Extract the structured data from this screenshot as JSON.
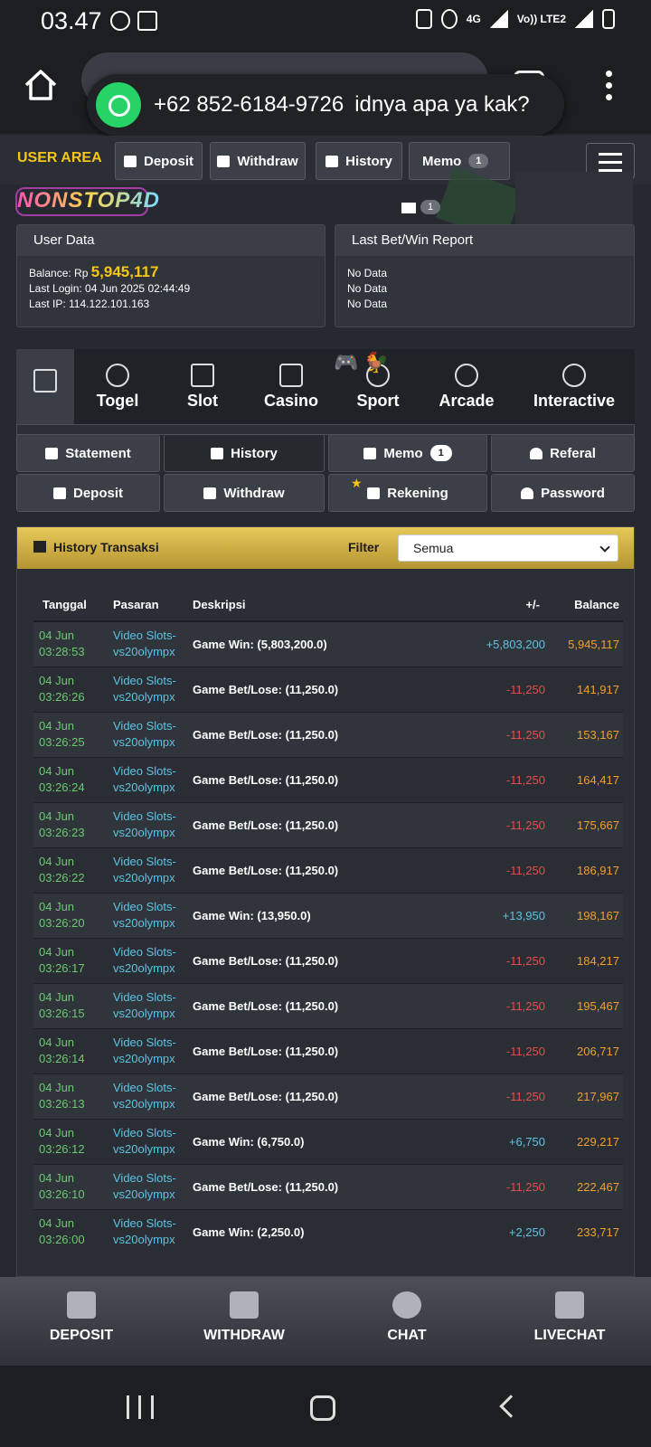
{
  "status_bar": {
    "time": "03.47",
    "network": "4G",
    "carrier": "Vo)) LTE2"
  },
  "whatsapp_toast": {
    "phone": "+62 852-6184-9726",
    "message": "idnya apa ya kak?"
  },
  "header": {
    "user_area_label": "USER AREA",
    "buttons": [
      "Deposit",
      "Withdraw",
      "History",
      "Memo"
    ],
    "memo_badge": "1"
  },
  "logo_text": "NONSTOP4D",
  "mail_badge": "1",
  "user_data": {
    "title": "User Data",
    "balance_label": "Balance: Rp",
    "balance_value": "5,945,117",
    "last_login": "Last Login: 04 Jun 2025 02:44:49",
    "last_ip": "Last IP: 114.122.101.163"
  },
  "last_bet": {
    "title": "Last Bet/Win Report",
    "lines": [
      "No Data",
      "No Data",
      "No Data"
    ]
  },
  "categories": [
    "Togel",
    "Slot",
    "Casino",
    "Sport",
    "Arcade",
    "Interactive"
  ],
  "menu_row1": [
    "Statement",
    "History",
    "Memo",
    "Referal"
  ],
  "menu_row1_memo_badge": "1",
  "menu_row2": [
    "Deposit",
    "Withdraw",
    "Rekening",
    "Password"
  ],
  "history": {
    "title": "History Transaksi",
    "filter_label": "Filter",
    "filter_value": "Semua",
    "columns": [
      "Tanggal",
      "Pasaran",
      "Deskripsi",
      "+/-",
      "Balance"
    ],
    "rows": [
      {
        "date": "04 Jun",
        "time": "03:28:53",
        "m1": "Video Slots-",
        "m2": "vs20olympx",
        "desc": "Game Win: (5,803,200.0)",
        "chg": "+5,803,200",
        "bal": "5,945,117"
      },
      {
        "date": "04 Jun",
        "time": "03:26:26",
        "m1": "Video Slots-",
        "m2": "vs20olympx",
        "desc": "Game Bet/Lose: (11,250.0)",
        "chg": "-11,250",
        "bal": "141,917"
      },
      {
        "date": "04 Jun",
        "time": "03:26:25",
        "m1": "Video Slots-",
        "m2": "vs20olympx",
        "desc": "Game Bet/Lose: (11,250.0)",
        "chg": "-11,250",
        "bal": "153,167"
      },
      {
        "date": "04 Jun",
        "time": "03:26:24",
        "m1": "Video Slots-",
        "m2": "vs20olympx",
        "desc": "Game Bet/Lose: (11,250.0)",
        "chg": "-11,250",
        "bal": "164,417"
      },
      {
        "date": "04 Jun",
        "time": "03:26:23",
        "m1": "Video Slots-",
        "m2": "vs20olympx",
        "desc": "Game Bet/Lose: (11,250.0)",
        "chg": "-11,250",
        "bal": "175,667"
      },
      {
        "date": "04 Jun",
        "time": "03:26:22",
        "m1": "Video Slots-",
        "m2": "vs20olympx",
        "desc": "Game Bet/Lose: (11,250.0)",
        "chg": "-11,250",
        "bal": "186,917"
      },
      {
        "date": "04 Jun",
        "time": "03:26:20",
        "m1": "Video Slots-",
        "m2": "vs20olympx",
        "desc": "Game Win: (13,950.0)",
        "chg": "+13,950",
        "bal": "198,167"
      },
      {
        "date": "04 Jun",
        "time": "03:26:17",
        "m1": "Video Slots-",
        "m2": "vs20olympx",
        "desc": "Game Bet/Lose: (11,250.0)",
        "chg": "-11,250",
        "bal": "184,217"
      },
      {
        "date": "04 Jun",
        "time": "03:26:15",
        "m1": "Video Slots-",
        "m2": "vs20olympx",
        "desc": "Game Bet/Lose: (11,250.0)",
        "chg": "-11,250",
        "bal": "195,467"
      },
      {
        "date": "04 Jun",
        "time": "03:26:14",
        "m1": "Video Slots-",
        "m2": "vs20olympx",
        "desc": "Game Bet/Lose: (11,250.0)",
        "chg": "-11,250",
        "bal": "206,717"
      },
      {
        "date": "04 Jun",
        "time": "03:26:13",
        "m1": "Video Slots-",
        "m2": "vs20olympx",
        "desc": "Game Bet/Lose: (11,250.0)",
        "chg": "-11,250",
        "bal": "217,967"
      },
      {
        "date": "04 Jun",
        "time": "03:26:12",
        "m1": "Video Slots-",
        "m2": "vs20olympx",
        "desc": "Game Win: (6,750.0)",
        "chg": "+6,750",
        "bal": "229,217"
      },
      {
        "date": "04 Jun",
        "time": "03:26:10",
        "m1": "Video Slots-",
        "m2": "vs20olympx",
        "desc": "Game Bet/Lose: (11,250.0)",
        "chg": "-11,250",
        "bal": "222,467"
      },
      {
        "date": "04 Jun",
        "time": "03:26:00",
        "m1": "Video Slots-",
        "m2": "vs20olympx",
        "desc": "Game Win: (2,250.0)",
        "chg": "+2,250",
        "bal": "233,717"
      }
    ]
  },
  "bottom_nav": [
    "DEPOSIT",
    "WITHDRAW",
    "CHAT",
    "LIVECHAT"
  ],
  "colors": {
    "accent_gold": "#f5c518",
    "positive": "#5fc3e4",
    "negative": "#e0504e",
    "balance": "#f0a030",
    "date": "#6ec972"
  }
}
